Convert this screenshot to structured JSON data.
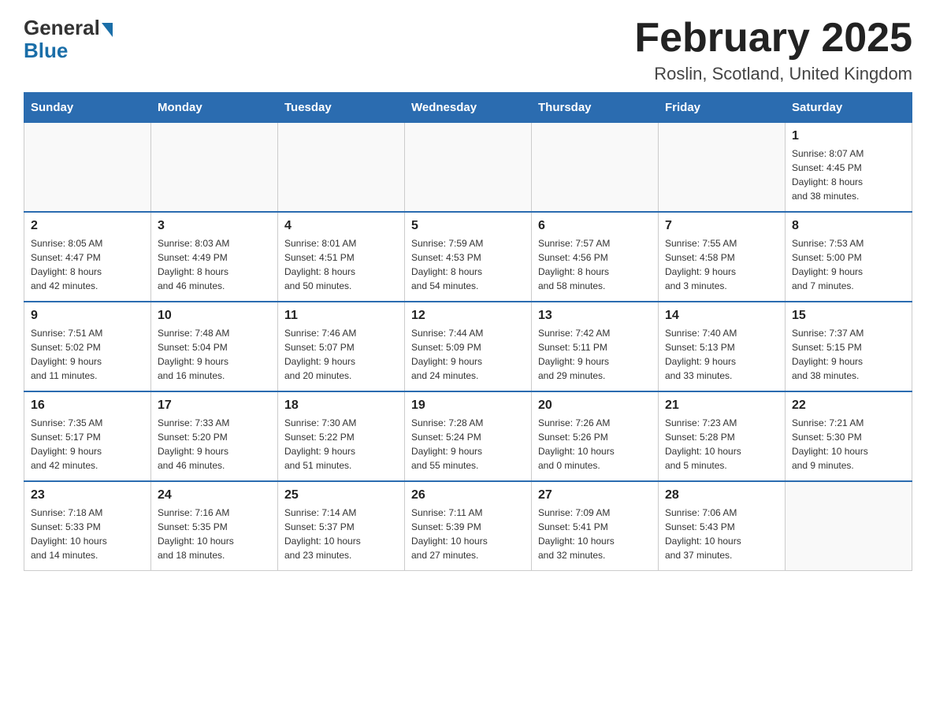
{
  "header": {
    "logo_general": "General",
    "logo_blue": "Blue",
    "month_title": "February 2025",
    "location": "Roslin, Scotland, United Kingdom"
  },
  "days_of_week": [
    "Sunday",
    "Monday",
    "Tuesday",
    "Wednesday",
    "Thursday",
    "Friday",
    "Saturday"
  ],
  "weeks": [
    [
      {
        "day": "",
        "info": ""
      },
      {
        "day": "",
        "info": ""
      },
      {
        "day": "",
        "info": ""
      },
      {
        "day": "",
        "info": ""
      },
      {
        "day": "",
        "info": ""
      },
      {
        "day": "",
        "info": ""
      },
      {
        "day": "1",
        "info": "Sunrise: 8:07 AM\nSunset: 4:45 PM\nDaylight: 8 hours\nand 38 minutes."
      }
    ],
    [
      {
        "day": "2",
        "info": "Sunrise: 8:05 AM\nSunset: 4:47 PM\nDaylight: 8 hours\nand 42 minutes."
      },
      {
        "day": "3",
        "info": "Sunrise: 8:03 AM\nSunset: 4:49 PM\nDaylight: 8 hours\nand 46 minutes."
      },
      {
        "day": "4",
        "info": "Sunrise: 8:01 AM\nSunset: 4:51 PM\nDaylight: 8 hours\nand 50 minutes."
      },
      {
        "day": "5",
        "info": "Sunrise: 7:59 AM\nSunset: 4:53 PM\nDaylight: 8 hours\nand 54 minutes."
      },
      {
        "day": "6",
        "info": "Sunrise: 7:57 AM\nSunset: 4:56 PM\nDaylight: 8 hours\nand 58 minutes."
      },
      {
        "day": "7",
        "info": "Sunrise: 7:55 AM\nSunset: 4:58 PM\nDaylight: 9 hours\nand 3 minutes."
      },
      {
        "day": "8",
        "info": "Sunrise: 7:53 AM\nSunset: 5:00 PM\nDaylight: 9 hours\nand 7 minutes."
      }
    ],
    [
      {
        "day": "9",
        "info": "Sunrise: 7:51 AM\nSunset: 5:02 PM\nDaylight: 9 hours\nand 11 minutes."
      },
      {
        "day": "10",
        "info": "Sunrise: 7:48 AM\nSunset: 5:04 PM\nDaylight: 9 hours\nand 16 minutes."
      },
      {
        "day": "11",
        "info": "Sunrise: 7:46 AM\nSunset: 5:07 PM\nDaylight: 9 hours\nand 20 minutes."
      },
      {
        "day": "12",
        "info": "Sunrise: 7:44 AM\nSunset: 5:09 PM\nDaylight: 9 hours\nand 24 minutes."
      },
      {
        "day": "13",
        "info": "Sunrise: 7:42 AM\nSunset: 5:11 PM\nDaylight: 9 hours\nand 29 minutes."
      },
      {
        "day": "14",
        "info": "Sunrise: 7:40 AM\nSunset: 5:13 PM\nDaylight: 9 hours\nand 33 minutes."
      },
      {
        "day": "15",
        "info": "Sunrise: 7:37 AM\nSunset: 5:15 PM\nDaylight: 9 hours\nand 38 minutes."
      }
    ],
    [
      {
        "day": "16",
        "info": "Sunrise: 7:35 AM\nSunset: 5:17 PM\nDaylight: 9 hours\nand 42 minutes."
      },
      {
        "day": "17",
        "info": "Sunrise: 7:33 AM\nSunset: 5:20 PM\nDaylight: 9 hours\nand 46 minutes."
      },
      {
        "day": "18",
        "info": "Sunrise: 7:30 AM\nSunset: 5:22 PM\nDaylight: 9 hours\nand 51 minutes."
      },
      {
        "day": "19",
        "info": "Sunrise: 7:28 AM\nSunset: 5:24 PM\nDaylight: 9 hours\nand 55 minutes."
      },
      {
        "day": "20",
        "info": "Sunrise: 7:26 AM\nSunset: 5:26 PM\nDaylight: 10 hours\nand 0 minutes."
      },
      {
        "day": "21",
        "info": "Sunrise: 7:23 AM\nSunset: 5:28 PM\nDaylight: 10 hours\nand 5 minutes."
      },
      {
        "day": "22",
        "info": "Sunrise: 7:21 AM\nSunset: 5:30 PM\nDaylight: 10 hours\nand 9 minutes."
      }
    ],
    [
      {
        "day": "23",
        "info": "Sunrise: 7:18 AM\nSunset: 5:33 PM\nDaylight: 10 hours\nand 14 minutes."
      },
      {
        "day": "24",
        "info": "Sunrise: 7:16 AM\nSunset: 5:35 PM\nDaylight: 10 hours\nand 18 minutes."
      },
      {
        "day": "25",
        "info": "Sunrise: 7:14 AM\nSunset: 5:37 PM\nDaylight: 10 hours\nand 23 minutes."
      },
      {
        "day": "26",
        "info": "Sunrise: 7:11 AM\nSunset: 5:39 PM\nDaylight: 10 hours\nand 27 minutes."
      },
      {
        "day": "27",
        "info": "Sunrise: 7:09 AM\nSunset: 5:41 PM\nDaylight: 10 hours\nand 32 minutes."
      },
      {
        "day": "28",
        "info": "Sunrise: 7:06 AM\nSunset: 5:43 PM\nDaylight: 10 hours\nand 37 minutes."
      },
      {
        "day": "",
        "info": ""
      }
    ]
  ]
}
